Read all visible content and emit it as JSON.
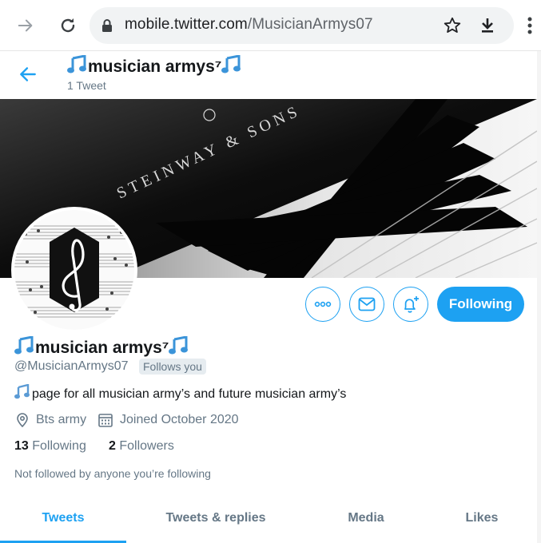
{
  "browser": {
    "url_domain": "mobile.twitter.com",
    "url_path": "/MusicianArmys07"
  },
  "header": {
    "name": "musician armys⁷",
    "tweet_count": "1 Tweet"
  },
  "banner": {
    "brand_text": "STEINWAY & SONS"
  },
  "actions": {
    "follow_label": "Following"
  },
  "profile": {
    "name": "musician armys⁷",
    "handle": "@MusicianArmys07",
    "follows_you": "Follows you",
    "bio": "page for all musician army’s and future musician army’s",
    "location": "Bts army",
    "joined": "Joined October 2020",
    "following_count": "13",
    "following_label": "Following",
    "followers_count": "2",
    "followers_label": "Followers",
    "not_followed": "Not followed by anyone you’re following"
  },
  "tabs": [
    {
      "label": "Tweets",
      "active": true
    },
    {
      "label": "Tweets & replies",
      "active": false
    },
    {
      "label": "Media",
      "active": false
    },
    {
      "label": "Likes",
      "active": false
    }
  ],
  "colors": {
    "accent": "#1da1f2",
    "secondary_text": "#657786",
    "primary_text": "#14171a"
  },
  "icons": [
    "forward-icon",
    "reload-icon",
    "lock-icon",
    "star-icon",
    "download-icon",
    "more-vert-icon",
    "back-arrow-icon",
    "music-note-icon",
    "more-icon",
    "message-icon",
    "bell-plus-icon",
    "location-icon",
    "calendar-icon"
  ]
}
